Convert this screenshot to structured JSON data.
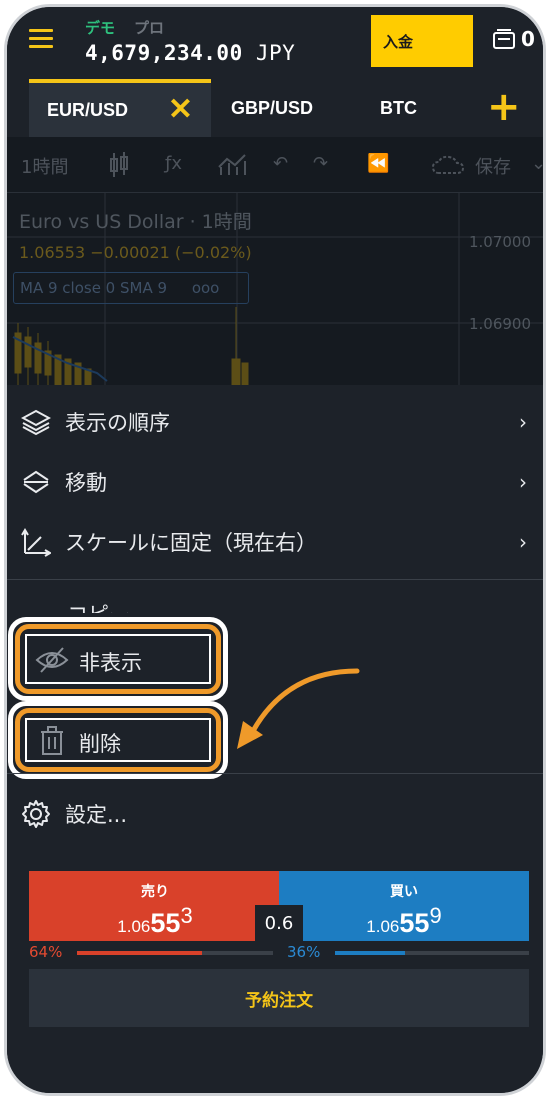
{
  "header": {
    "demo_label": "デモ",
    "pro_label": "プロ",
    "balance_amount": "4,679,234.00",
    "balance_currency": "JPY",
    "deposit_label": "入金",
    "clipped_text": "0"
  },
  "tabs": [
    {
      "label": "EUR/USD",
      "active": true,
      "close_glyph": "✕"
    },
    {
      "label": "GBP/USD"
    },
    {
      "label": "BTC"
    }
  ],
  "add_tab_glyph": "+",
  "chart": {
    "interval": "1時間",
    "fx_glyph": "ƒx",
    "save_label": "保存",
    "title": "Euro vs US Dollar · 1時間",
    "quote": "1.06553  −0.00021 (−0.02%)",
    "ma_label": "MA 9 close 0 SMA 9",
    "ma_more": "ooo",
    "price_high": "1.07000",
    "price_low": "1.06900"
  },
  "menu": {
    "items": [
      {
        "label": "表示の順序",
        "icon": "layers-icon",
        "chevron": "›"
      },
      {
        "label": "移動",
        "icon": "move-arrows-icon",
        "chevron": "›"
      },
      {
        "label": "スケールに固定（現在右）",
        "icon": "axis-scale-icon",
        "chevron": "›"
      }
    ],
    "copy_label": "コピー",
    "hide_label": "非表示",
    "delete_label": "削除",
    "settings_label": "設定..."
  },
  "trade": {
    "sell_label": "売り",
    "sell_price_small": "1.06",
    "sell_price_big": "55",
    "sell_price_sup": "3",
    "buy_label": "買い",
    "buy_price_small": "1.06",
    "buy_price_big": "55",
    "buy_price_sup": "9",
    "spread": "0.6",
    "sell_pct": "64%",
    "buy_pct": "36%",
    "sell_ratio": 0.64,
    "buy_ratio": 0.36,
    "order_label": "予約注文"
  },
  "colors": {
    "accent": "#f5c518",
    "sell": "#d9412a",
    "buy": "#1d7dc2",
    "highlight": "#ef9a2a",
    "background": "#1d2229"
  }
}
